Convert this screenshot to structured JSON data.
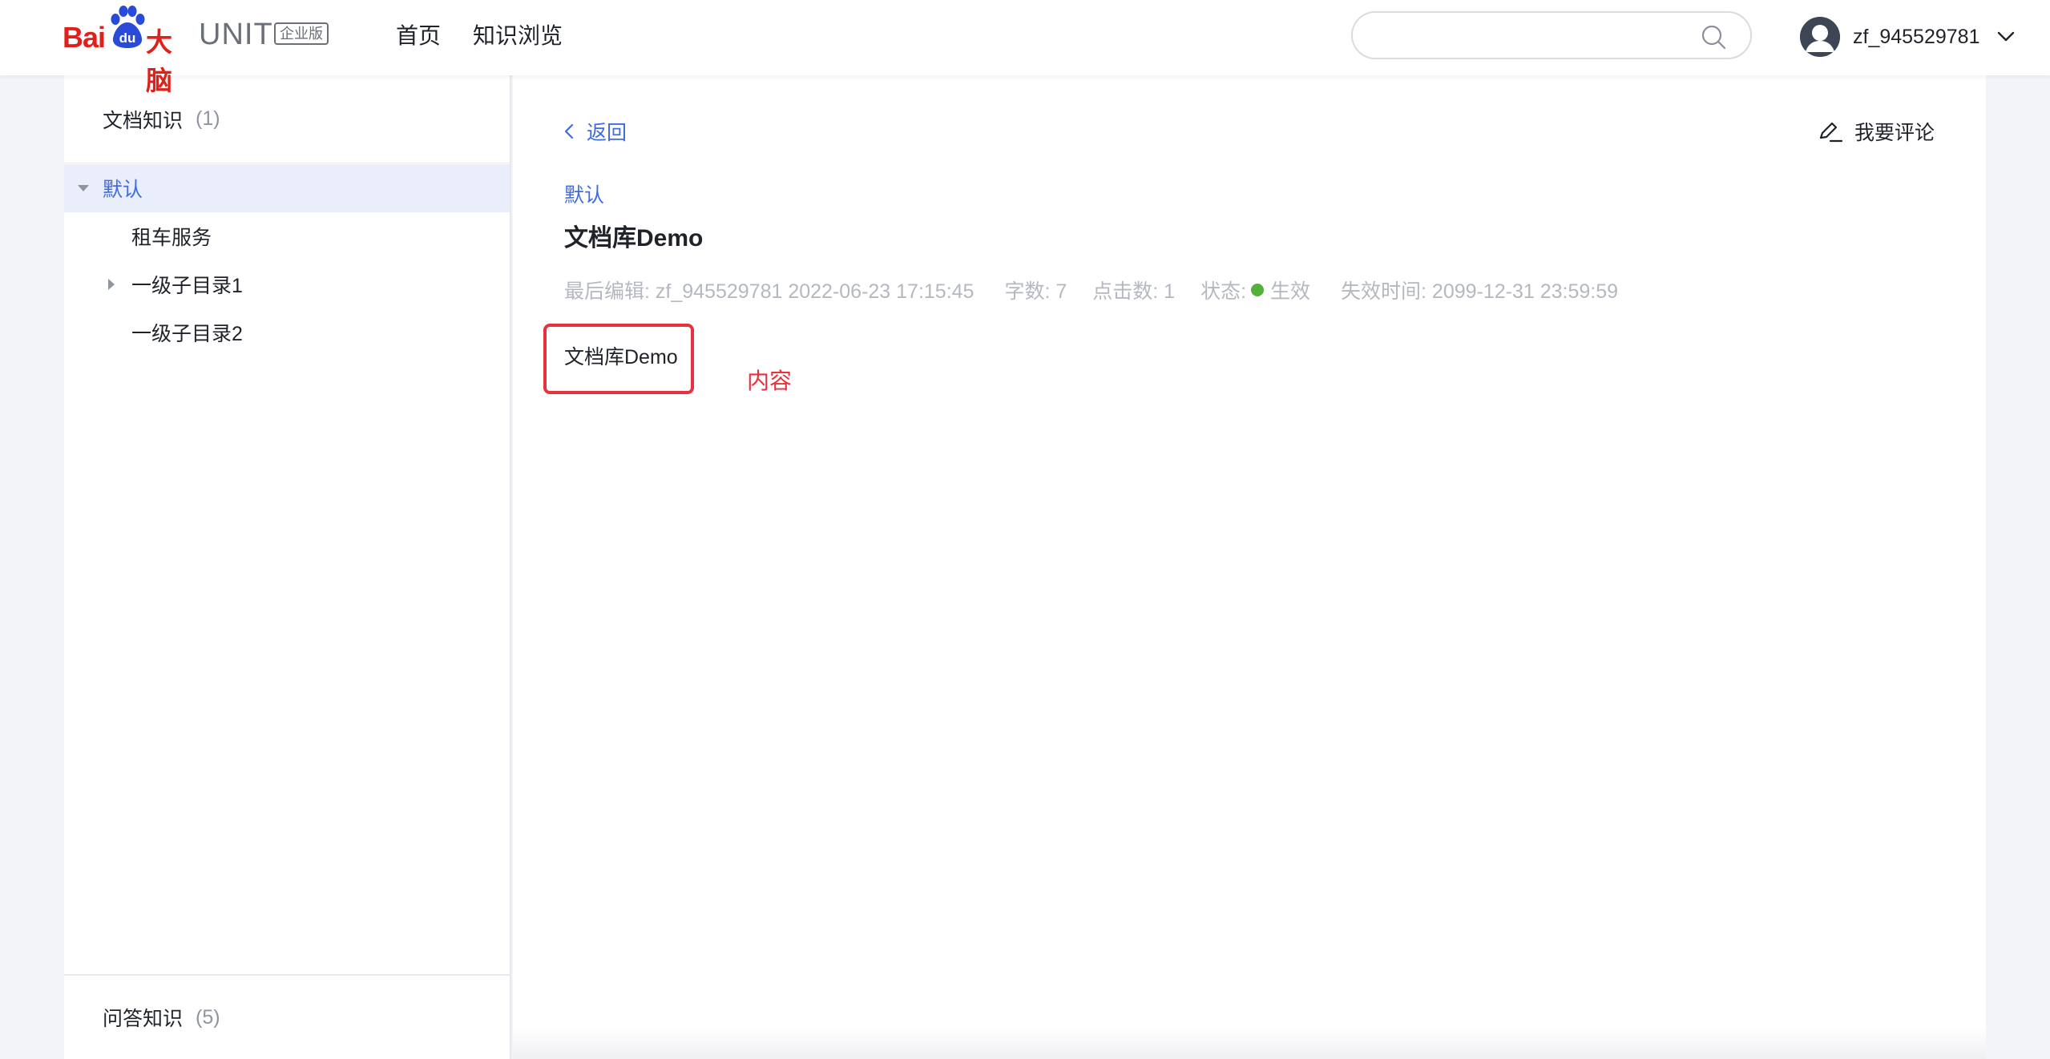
{
  "brand": {
    "bai": "Bai",
    "du": "du",
    "danao": "大脑",
    "unit": "UNIT",
    "badge": "企业版",
    "accent": "#e0211b"
  },
  "topnav": {
    "home": "首页",
    "browse": "知识浏览"
  },
  "search": {
    "placeholder": "",
    "value": ""
  },
  "user": {
    "name": "zf_945529781"
  },
  "sidebar": {
    "doc_section": {
      "label": "文档知识",
      "count": "(1)"
    },
    "tree": [
      {
        "label": "默认",
        "expanded": true,
        "active": true
      },
      {
        "label": "租车服务"
      },
      {
        "label": "一级子目录1",
        "has_children": true
      },
      {
        "label": "一级子目录2"
      }
    ],
    "qa_section": {
      "label": "问答知识",
      "count": "(5)"
    }
  },
  "main": {
    "back_label": "返回",
    "comment_label": "我要评论",
    "category": "默认",
    "title": "文档库Demo",
    "meta": {
      "last_edit": "最后编辑: zf_945529781 2022-06-23 17:15:45",
      "word_count": "字数: 7",
      "clicks": "点击数: 1",
      "status_label": "状态:",
      "status_value": "生效",
      "status_color": "#52b13b",
      "expire": "失效时间: 2099-12-31 23:59:59"
    },
    "content": "文档库Demo",
    "annotation": "内容"
  },
  "colors": {
    "link": "#3f6ae0",
    "annotation_red": "#e5323e",
    "active_bg": "#eaeefa"
  }
}
